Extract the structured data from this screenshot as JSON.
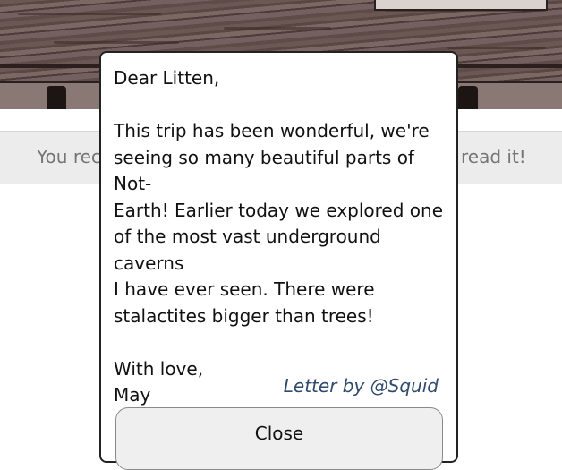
{
  "notification": {
    "left_text": "You rec",
    "right_text": "read it!"
  },
  "letter": {
    "greeting": "Dear Litten,",
    "lines": [
      "This trip has been wonderful, we're",
      "seeing so many beautiful parts of Not-",
      "Earth! Earlier today we explored one",
      "of the most vast underground caverns",
      "I have ever seen. There were",
      "stalactites bigger than trees!"
    ],
    "closing": "With love,",
    "sender": "May",
    "credit": "Letter by @Squid"
  },
  "buttons": {
    "close_label": "Close"
  },
  "colors": {
    "credit_text": "#2f4a6b",
    "notice_bg": "#ececec",
    "wood": "#6b5753"
  }
}
